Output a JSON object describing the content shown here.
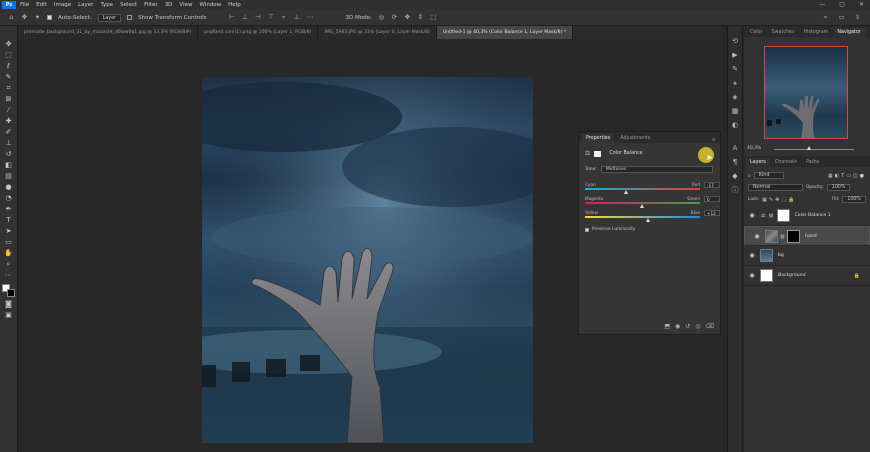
{
  "app": {
    "logo": "Ps"
  },
  "menu": [
    "File",
    "Edit",
    "Image",
    "Layer",
    "Type",
    "Select",
    "Filter",
    "3D",
    "View",
    "Window",
    "Help"
  ],
  "window_controls": [
    "—",
    "▢",
    "✕"
  ],
  "options_bar": {
    "auto_select_label": "Auto-Select:",
    "auto_select_target": "Layer",
    "show_transform_label": "Show Transform Controls",
    "mode_3d": "3D Mode:"
  },
  "tabs": [
    {
      "label": "premade_background_31_by_maiarcht_d6ww0q1.jpg @ 33,3% (RGB/8#)",
      "active": false
    },
    {
      "label": "pngfand.com(1).png @ 100% (Layer 1, RGB/8)",
      "active": false
    },
    {
      "label": "IMG_5983.JPG @ 33% (Layer 0, Layer Mask/8)",
      "active": false
    },
    {
      "label": "Untitled-1 @ 40,3% (Color Balance 1, Layer Mask/8) *",
      "active": true
    }
  ],
  "properties": {
    "tabs": [
      "Properties",
      "Adjustments"
    ],
    "adjustment_name": "Color Balance",
    "tone_label": "Tone:",
    "tone_value": "Midtones",
    "sliders": [
      {
        "left": "Cyan",
        "right": "Red",
        "value": "-17",
        "pos": 0.36,
        "from": "#00bcd4",
        "to": "#e53935"
      },
      {
        "left": "Magenta",
        "right": "Green",
        "value": "0",
        "pos": 0.5,
        "from": "#d81b60",
        "to": "#43a047"
      },
      {
        "left": "Yellow",
        "right": "Blue",
        "value": "+12",
        "pos": 0.55,
        "from": "#fdd835",
        "to": "#1e88e5"
      }
    ],
    "preserve_luminosity": "Preserve Luminosity"
  },
  "navigator": {
    "tabs": [
      "Color",
      "Swatches",
      "Histogram",
      "Navigator"
    ],
    "zoom": "40,3%"
  },
  "layers_panel": {
    "tabs": [
      "Layers",
      "Channels",
      "Paths"
    ],
    "filter_kind": "Kind",
    "blend_mode": "Normal",
    "opacity_label": "Opacity:",
    "opacity": "100%",
    "lock_label": "Lock:",
    "fill_label": "Fill:",
    "fill": "100%",
    "layers": [
      {
        "name": "Color Balance 1",
        "type": "adjustment",
        "selected": false
      },
      {
        "name": "hand",
        "type": "image",
        "selected": true
      },
      {
        "name": "bg",
        "type": "image",
        "selected": false
      },
      {
        "name": "Background",
        "type": "background",
        "selected": false
      }
    ]
  },
  "colors": {
    "accent": "#1473e6",
    "panel": "#353535",
    "canvas_bg": "#282828"
  }
}
